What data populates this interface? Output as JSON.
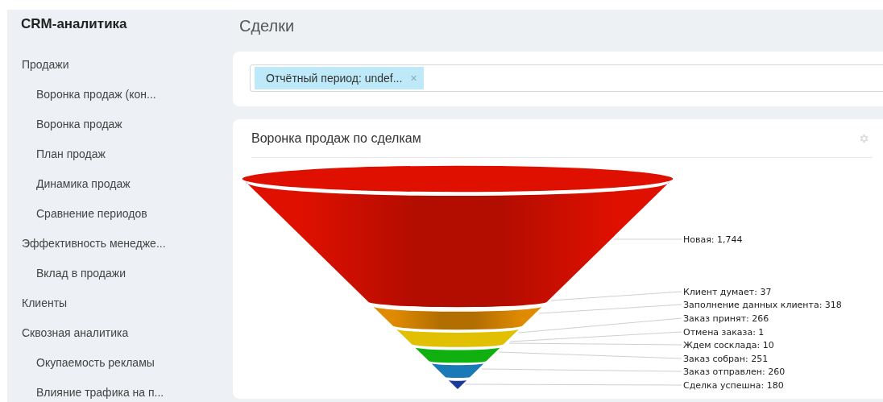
{
  "sidebar": {
    "title": "CRM-аналитика",
    "items": [
      {
        "label": "Продажи",
        "children": [
          {
            "label": "Воронка продаж (кон..."
          },
          {
            "label": "Воронка продаж"
          },
          {
            "label": "План продаж"
          },
          {
            "label": "Динамика продаж"
          },
          {
            "label": "Сравнение периодов"
          }
        ]
      },
      {
        "label": "Эффективность менедже...",
        "children": [
          {
            "label": "Вклад в продажи"
          }
        ]
      },
      {
        "label": "Клиенты"
      },
      {
        "label": "Сквозная аналитика",
        "children": [
          {
            "label": "Окупаемость рекламы"
          },
          {
            "label": "Влияние трафика на п..."
          }
        ]
      }
    ]
  },
  "page_title": "Сделки",
  "filter": {
    "chips": [
      {
        "label": "Отчётный период: undef...",
        "remove": "×"
      }
    ]
  },
  "chart_card": {
    "title": "Воронка продаж по сделкам",
    "segments": [
      {
        "color": "#e01000"
      },
      {
        "color": "#e08a00"
      },
      {
        "color": "#e0c000"
      },
      {
        "color": "#10b010"
      },
      {
        "color": "#1a7ab8"
      },
      {
        "color": "#1a3a9a"
      }
    ],
    "labels": [
      "Новая: 1,744",
      "Клиент думает: 37",
      "Заполнение данных клиента: 318",
      "Заказ принят: 266",
      "Отмена заказа: 1",
      "Ждем сосклада: 10",
      "Заказ собран: 251",
      "Заказ отправлен: 260",
      "Сделка успешна: 180"
    ]
  }
}
